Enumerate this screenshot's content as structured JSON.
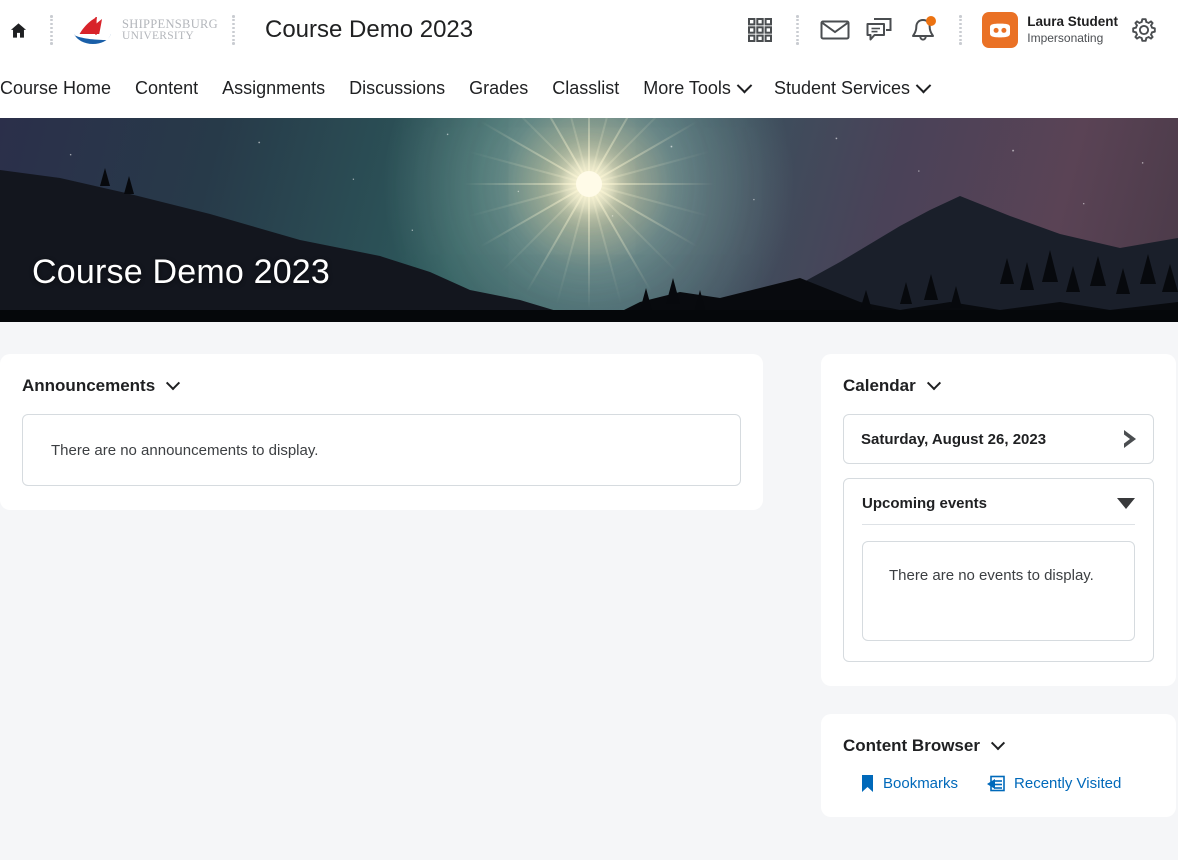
{
  "header": {
    "home_icon": "home-icon",
    "logo": {
      "line1": "SHIPPENSBURG",
      "line2": "UNIVERSITY",
      "mark": "ship-logo-icon"
    },
    "course_title": "Course Demo 2023",
    "icons": {
      "waffle": "grid-apps-icon",
      "mail": "envelope-icon",
      "messages": "chat-bubbles-icon",
      "alerts": "bell-icon",
      "settings": "gear-icon"
    },
    "alerts_badge": true,
    "user": {
      "name": "Laura Student",
      "status": "Impersonating",
      "avatar_icon": "mask-avatar-icon"
    }
  },
  "nav": {
    "items": [
      {
        "label": "Course Home",
        "has_dropdown": false
      },
      {
        "label": "Content",
        "has_dropdown": false
      },
      {
        "label": "Assignments",
        "has_dropdown": false
      },
      {
        "label": "Discussions",
        "has_dropdown": false
      },
      {
        "label": "Grades",
        "has_dropdown": false
      },
      {
        "label": "Classlist",
        "has_dropdown": false
      },
      {
        "label": "More Tools",
        "has_dropdown": true
      },
      {
        "label": "Student Services",
        "has_dropdown": true
      }
    ]
  },
  "banner": {
    "title": "Course Demo 2023",
    "image_description": "night-mountain-landscape"
  },
  "announcements": {
    "title": "Announcements",
    "empty_text": "There are no announcements to display."
  },
  "calendar": {
    "title": "Calendar",
    "date": "Saturday, August 26, 2023",
    "next_icon": "triangle-right-icon",
    "upcoming": {
      "title": "Upcoming events",
      "collapse_icon": "triangle-down-icon",
      "empty_text": "There are no events to display."
    }
  },
  "content_browser": {
    "title": "Content Browser",
    "links": [
      {
        "label": "Bookmarks",
        "icon": "bookmark-icon"
      },
      {
        "label": "Recently Visited",
        "icon": "recently-visited-icon"
      }
    ]
  },
  "colors": {
    "accent_orange": "#ea7125",
    "link_blue": "#0069ba",
    "page_bg": "#f5f6f8",
    "logo_red": "#d8232a",
    "logo_blue": "#1a5fa8"
  }
}
